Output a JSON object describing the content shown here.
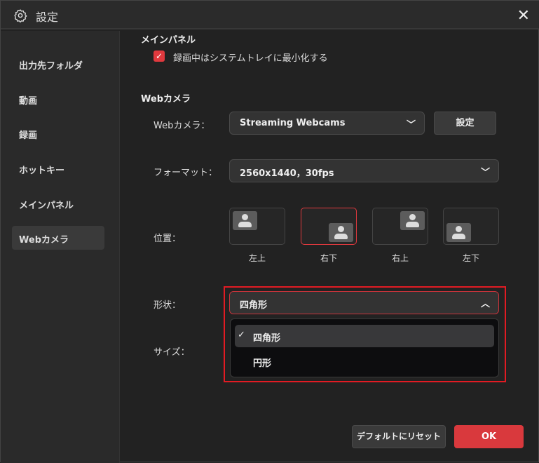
{
  "window": {
    "title": "設定",
    "close_icon": "close-icon",
    "gear_icon": "gear-icon"
  },
  "sidebar": {
    "items": [
      {
        "label": "出力先フォルダ"
      },
      {
        "label": "動画"
      },
      {
        "label": "録画"
      },
      {
        "label": "ホットキー"
      },
      {
        "label": "メインパネル"
      },
      {
        "label": "Webカメラ",
        "active": true
      }
    ]
  },
  "main_panel": {
    "heading": "メインパネル",
    "minimize_to_tray": {
      "label": "録画中はシステムトレイに最小化する",
      "checked": true
    }
  },
  "webcam": {
    "heading": "Webカメラ",
    "camera_label": "Webカメラ：",
    "camera_value": "Streaming Webcams",
    "settings_button": "設定",
    "format_label": "フォーマット：",
    "format_value": "2560x1440，30fps",
    "position_label": "位置：",
    "positions": [
      {
        "label": "左上"
      },
      {
        "label": "右下",
        "selected": true
      },
      {
        "label": "右上"
      },
      {
        "label": "左下"
      }
    ],
    "shape_label": "形状：",
    "shape_value": "四角形",
    "shape_options": [
      {
        "label": "四角形",
        "selected": true
      },
      {
        "label": "円形"
      }
    ],
    "size_label": "サイズ："
  },
  "footer": {
    "reset_button": "デフォルトにリセット",
    "ok_button": "OK"
  },
  "colors": {
    "accent": "#e0393e",
    "highlight_box": "#e21b23"
  }
}
